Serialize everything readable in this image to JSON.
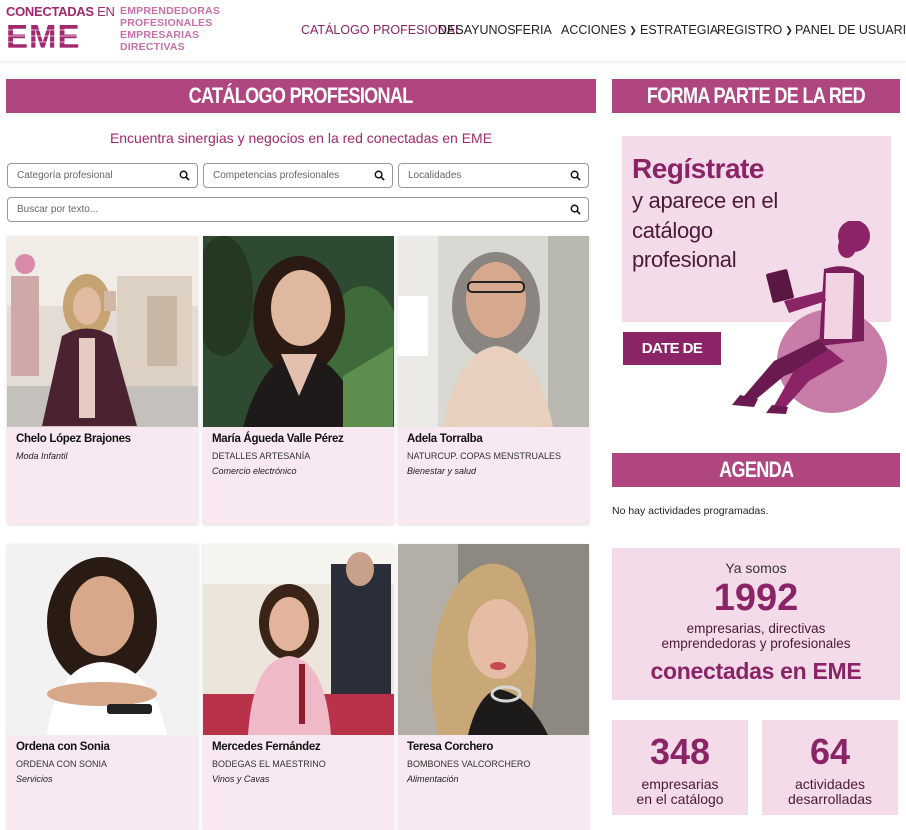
{
  "header": {
    "logo_top": "CONECTADAS",
    "logo_en": "EN",
    "logo_main": "EME",
    "tagline": [
      "EMPRENDEDORAS",
      "PROFESIONALES",
      "EMPRESARIAS",
      "DIRECTIVAS"
    ],
    "nav": [
      {
        "label": "CATÁLOGO PROFESIONAL",
        "active": true
      },
      {
        "label": "DESAYUNOS"
      },
      {
        "label": "FERIA"
      },
      {
        "label": "ACCIONES",
        "dropdown": true
      },
      {
        "label": "ESTRATEGIA"
      },
      {
        "label": "REGISTRO",
        "dropdown": true
      },
      {
        "label": "PANEL DE USUARIA"
      }
    ]
  },
  "catalog": {
    "title": "CATÁLOGO PROFESIONAL",
    "subtitle": "Encuentra sinergias y negocios en la red conectadas en EME",
    "filters": {
      "category": "Categoría profesional",
      "skills": "Competencias profesionales",
      "locations": "Localidades",
      "search": "Buscar por texto..."
    },
    "cards": [
      {
        "name": "Chelo López Brajones",
        "company": "",
        "category": "Moda Infantil"
      },
      {
        "name": "María Águeda Valle Pérez",
        "company": "DETALLES ARTESANÍA",
        "category": "Comercio electrónico"
      },
      {
        "name": "Adela Torralba",
        "company": "NATURCUP. COPAS MENSTRUALES",
        "category": "Bienestar y salud"
      },
      {
        "name": "Ordena con Sonia",
        "company": "ORDENA CON SONIA",
        "category": "Servicios"
      },
      {
        "name": "Mercedes Fernández",
        "company": "BODEGAS EL MAESTRINO",
        "category": "Vinos y Cavas"
      },
      {
        "name": "Teresa Corchero",
        "company": "BOMBONES VALCORCHERO",
        "category": "Alimentación"
      }
    ]
  },
  "sidebar": {
    "join_title": "FORMA PARTE DE LA RED",
    "promo_heading": "Regístrate",
    "promo_lines": [
      "y aparece en el",
      "catálogo",
      "profesional"
    ],
    "signup_button": "DATE DE ALTA",
    "agenda_title": "AGENDA",
    "agenda_empty": "No hay actividades programadas.",
    "stats": {
      "intro": "Ya somos",
      "members": "1992",
      "members_desc": [
        "empresarias, directivas",
        "emprendedoras y profesionales"
      ],
      "members_tag": "conectadas en EME",
      "catalog_count": "348",
      "catalog_desc": [
        "empresarias",
        "en el catálogo"
      ],
      "activities_count": "64",
      "activities_desc": [
        "actividades",
        "desarrolladas"
      ]
    }
  },
  "colors": {
    "brand": "#a0286e",
    "bar": "#b0467f",
    "card_bg": "#f7e8f1",
    "promo_bg": "#f4dbe9"
  }
}
